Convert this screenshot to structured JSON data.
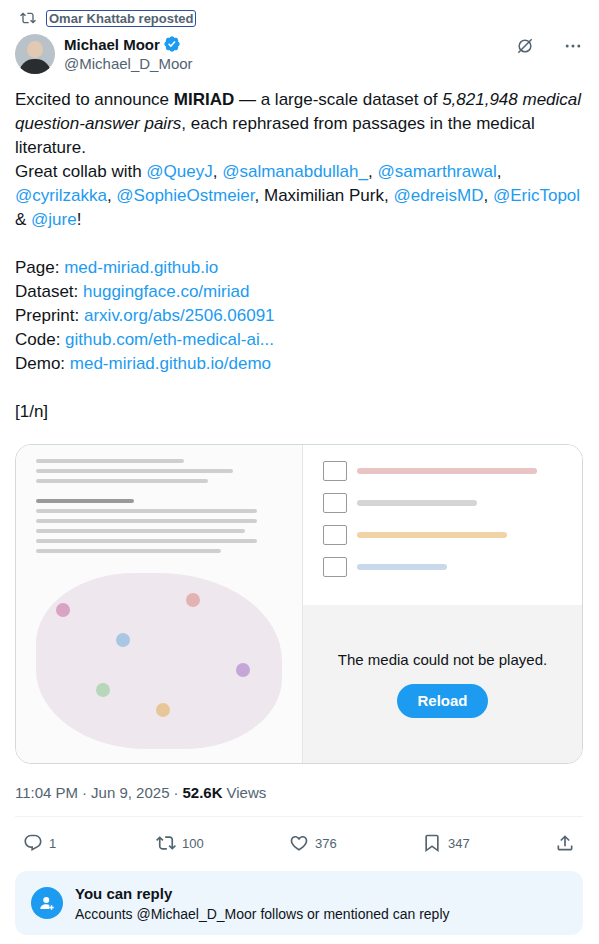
{
  "repost": {
    "text": "Omar Khattab reposted"
  },
  "author": {
    "name": "Michael Moor",
    "handle": "@Michael_D_Moor",
    "verified": true
  },
  "body": [
    [
      [
        {
          "text": "Excited to announce ",
          "kind": "plain"
        },
        {
          "text": "MIRIAD",
          "kind": "bold"
        },
        {
          "text": " — a large-scale dataset of ",
          "kind": "plain"
        },
        {
          "text": "5,821,948 medical question-answer pairs",
          "kind": "italic"
        },
        {
          "text": ", each rephrased from passages in the medical literature.",
          "kind": "plain"
        }
      ],
      [
        {
          "text": "Great collab with ",
          "kind": "plain"
        },
        {
          "text": "@QueyJ",
          "kind": "link"
        },
        {
          "text": ", ",
          "kind": "plain"
        },
        {
          "text": "@salmanabdullah_",
          "kind": "link"
        },
        {
          "text": ", ",
          "kind": "plain"
        },
        {
          "text": "@samarthrawal",
          "kind": "link"
        },
        {
          "text": ", ",
          "kind": "plain"
        },
        {
          "text": "@cyrilzakka",
          "kind": "link"
        },
        {
          "text": ", ",
          "kind": "plain"
        },
        {
          "text": "@SophieOstmeier",
          "kind": "link"
        },
        {
          "text": ", Maximilian Purk, ",
          "kind": "plain"
        },
        {
          "text": "@edreisMD",
          "kind": "link"
        },
        {
          "text": ", ",
          "kind": "plain"
        },
        {
          "text": "@EricTopol",
          "kind": "link"
        },
        {
          "text": " & ",
          "kind": "plain"
        },
        {
          "text": "@jure",
          "kind": "link"
        },
        {
          "text": "!",
          "kind": "plain"
        }
      ]
    ],
    [
      [
        {
          "text": "Page: ",
          "kind": "plain"
        },
        {
          "text": "med-miriad.github.io",
          "kind": "link"
        }
      ],
      [
        {
          "text": "Dataset: ",
          "kind": "plain"
        },
        {
          "text": "huggingface.co/miriad",
          "kind": "link"
        }
      ],
      [
        {
          "text": "Preprint: ",
          "kind": "plain"
        },
        {
          "text": "arxiv.org/abs/2506.06091",
          "kind": "link"
        }
      ],
      [
        {
          "text": "Code: ",
          "kind": "plain"
        },
        {
          "text": "github.com/eth-medical-ai...",
          "kind": "link"
        }
      ],
      [
        {
          "text": "Demo: ",
          "kind": "plain"
        },
        {
          "text": "med-miriad.github.io/demo",
          "kind": "link"
        }
      ]
    ],
    [
      [
        {
          "text": "[1/n]",
          "kind": "plain"
        }
      ]
    ]
  ],
  "media": {
    "error": "The media could not be played.",
    "button": "Reload"
  },
  "meta": {
    "time": "11:04 PM",
    "separator": "·",
    "date": "Jun 9, 2025",
    "views": "52.6K",
    "views_label": "Views"
  },
  "actions": [
    {
      "kind": "reply",
      "count": "1"
    },
    {
      "kind": "repost",
      "count": "100"
    },
    {
      "kind": "like",
      "count": "376"
    },
    {
      "kind": "bookmark",
      "count": "347"
    }
  ],
  "reply_notice": {
    "title": "You can reply",
    "text": "Accounts @Michael_D_Moor follows or mentioned can reply"
  }
}
